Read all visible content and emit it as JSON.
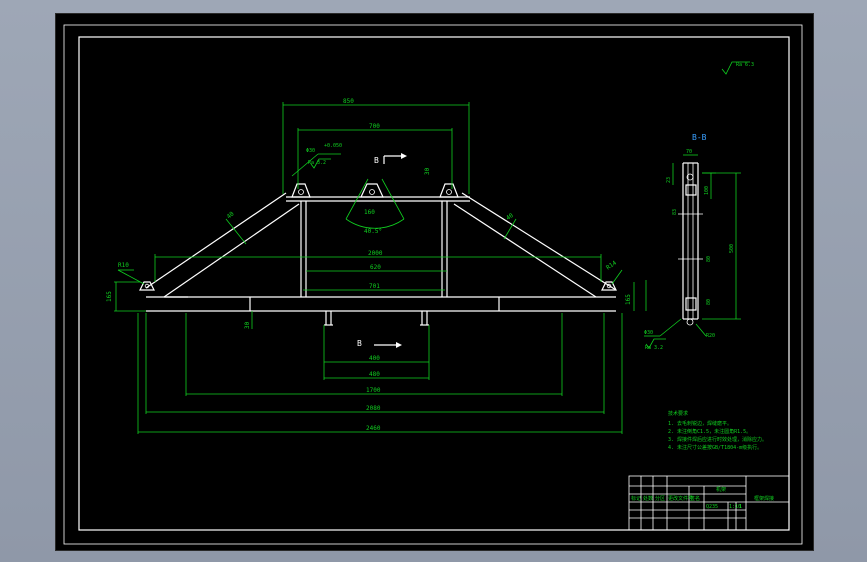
{
  "drawing": {
    "section_title": "B-B",
    "view_marker_top": "B",
    "view_marker_bottom": "B",
    "surface_finish_general": "Ra 6.3",
    "dims": {
      "d850": "850",
      "d700": "700",
      "d2000": "2000",
      "d620": "620",
      "d701": "701",
      "d1700": "1700",
      "d2080": "2080",
      "d2460": "2460",
      "d400": "400",
      "d480": "480",
      "d160": "160",
      "d165": "165",
      "d30": "30",
      "d40": "40",
      "d45deg": "40.5°",
      "R10": "R10",
      "R14": "R14",
      "R20": "R20",
      "d70": "70",
      "d100": "100",
      "d23": "23",
      "d83": "83",
      "d80": "80",
      "d500": "500",
      "ra32a": "Ra 3.2",
      "ra32b": "Ra 3.2",
      "phi30": "Φ30",
      "phi_sym": "+0.050"
    },
    "notes": {
      "title": "技术要求",
      "lines": [
        "1. 去毛刺锐边，焊缝磨平。",
        "2. 未注倒角C1.5，未注圆角R1.5。",
        "3. 焊接件焊后应进行时效处理，消除应力。",
        "4. 未注尺寸公差按GB/T1804-m级执行。"
      ]
    },
    "title_block": {
      "part_name": "机架",
      "drawing_name": "框架焊接",
      "material": "Q235",
      "scale": "1:10",
      "sheet": "1",
      "rows": [
        "标记",
        "处数",
        "分区",
        "更改文件号",
        "签名",
        "年月日"
      ]
    }
  }
}
